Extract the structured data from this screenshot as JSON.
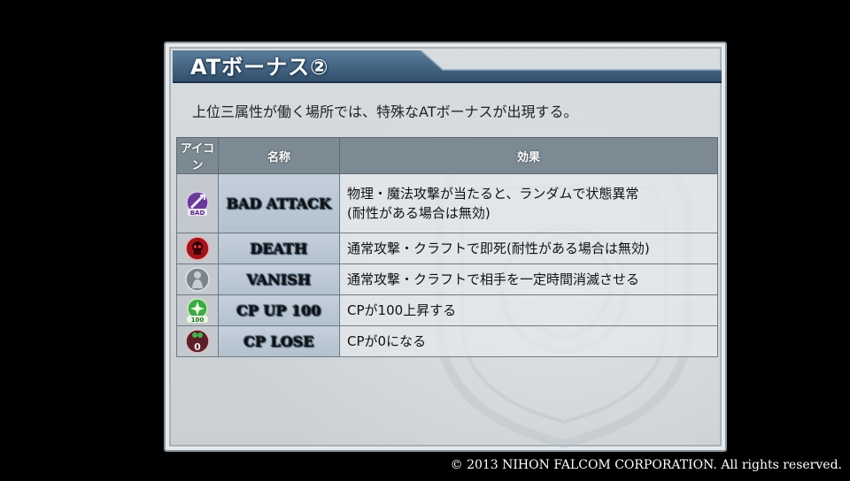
{
  "title": "ATボーナス②",
  "description": "上位三属性が働く場所では、特殊なATボーナスが出現する。",
  "table": {
    "headers": {
      "icon": "アイコン",
      "name": "名称",
      "effect": "効果"
    },
    "rows": [
      {
        "icon": "bad-attack-icon",
        "name": "BAD ATTACK",
        "effect_line1": "物理・魔法攻撃が当たると、ランダムで状態異常",
        "effect_line2": "(耐性がある場合は無効)",
        "badge_text": "BAD"
      },
      {
        "icon": "death-icon",
        "name": "DEATH",
        "effect": "通常攻撃・クラフトで即死(耐性がある場合は無効)"
      },
      {
        "icon": "vanish-icon",
        "name": "VANISH",
        "effect": "通常攻撃・クラフトで相手を一定時間消滅させる"
      },
      {
        "icon": "cp-up-icon",
        "name": "CP UP 100",
        "effect": "CPが100上昇する",
        "badge_text": "100"
      },
      {
        "icon": "cp-lose-icon",
        "name": "CP LOSE",
        "effect": "CPが0になる",
        "badge_text": "0"
      }
    ]
  },
  "copyright": "© 2013 NIHON FALCOM CORPORATION. All rights reserved.",
  "colors": {
    "title_bar": "#3d5f80",
    "header_bg": "#7c8a93",
    "death_red": "#b3121c",
    "cp_green": "#3fa84a",
    "bad_purple": "#7a3fae"
  }
}
